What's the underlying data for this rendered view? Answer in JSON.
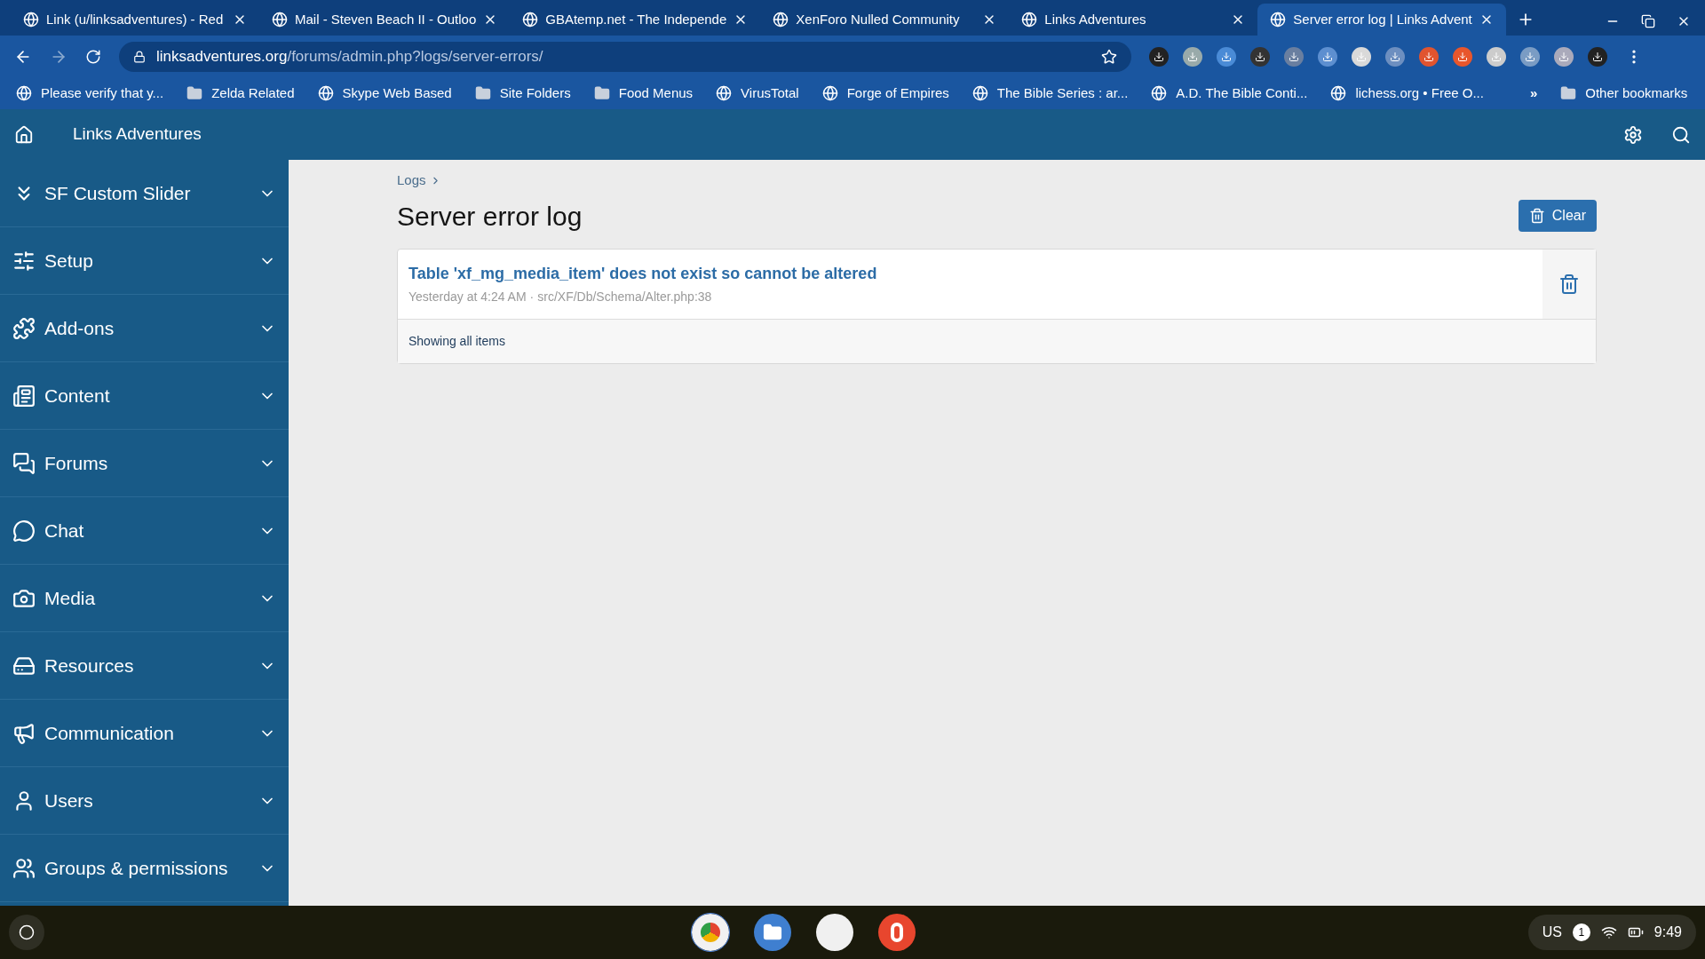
{
  "browser": {
    "tabs": [
      {
        "title": "Link (u/linksadventures) - Red",
        "selected": false
      },
      {
        "title": "Mail - Steven Beach II - Outloo",
        "selected": false
      },
      {
        "title": "GBAtemp.net - The Independe",
        "selected": false
      },
      {
        "title": "XenForo Nulled Community",
        "selected": false
      },
      {
        "title": "Links Adventures",
        "selected": false
      },
      {
        "title": "Server error log | Links Advent",
        "selected": true
      }
    ],
    "address": {
      "host": "linksadventures.org",
      "path": "/forums/admin.php?logs/server-errors/"
    },
    "bookmarks": [
      {
        "label": "Please verify that y...",
        "kind": "site"
      },
      {
        "label": "Zelda Related",
        "kind": "folder"
      },
      {
        "label": "Skype Web Based",
        "kind": "site"
      },
      {
        "label": "Site Folders",
        "kind": "folder"
      },
      {
        "label": "Food Menus",
        "kind": "folder"
      },
      {
        "label": "VirusTotal",
        "kind": "site"
      },
      {
        "label": "Forge of Empires",
        "kind": "site"
      },
      {
        "label": "The Bible Series : ar...",
        "kind": "site"
      },
      {
        "label": "A.D. The Bible Conti...",
        "kind": "site"
      },
      {
        "label": "lichess.org • Free O...",
        "kind": "site"
      }
    ],
    "overflow": "»",
    "other_bookmarks": "Other bookmarks"
  },
  "header": {
    "title": "Links Adventures"
  },
  "sidebar": {
    "items": [
      {
        "label": "SF Custom Slider",
        "expanded": false
      },
      {
        "label": "Setup",
        "expanded": false
      },
      {
        "label": "Add-ons",
        "expanded": false
      },
      {
        "label": "Content",
        "expanded": false
      },
      {
        "label": "Forums",
        "expanded": false
      },
      {
        "label": "Chat",
        "expanded": false
      },
      {
        "label": "Media",
        "expanded": false
      },
      {
        "label": "Resources",
        "expanded": false
      },
      {
        "label": "Communication",
        "expanded": false
      },
      {
        "label": "Users",
        "expanded": false
      },
      {
        "label": "Groups & permissions",
        "expanded": false
      }
    ]
  },
  "main": {
    "breadcrumb": "Logs",
    "title": "Server error log",
    "clear_button": "Clear",
    "errors": [
      {
        "message": "Table 'xf_mg_media_item' does not exist so cannot be altered",
        "time": "Yesterday at 4:24 AM",
        "separator": "·",
        "location": "src/XF/Db/Schema/Alter.php:38"
      }
    ],
    "footer": "Showing all items"
  },
  "taskbar": {
    "locale": "US",
    "notifications": "1",
    "time": "9:49"
  }
}
